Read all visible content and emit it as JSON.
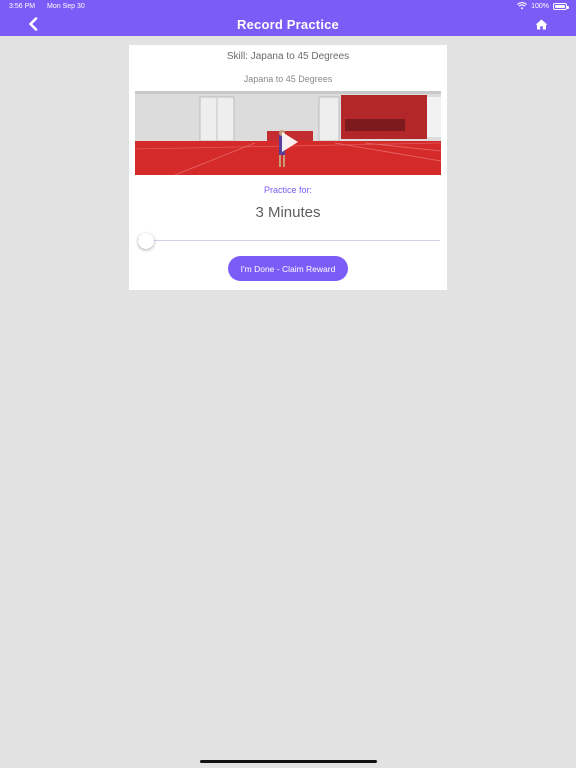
{
  "status_bar": {
    "time": "3:56 PM",
    "date": "Mon Sep 30",
    "battery_text": "100%",
    "wifi_icon": "wifi-icon",
    "battery_icon": "battery-icon"
  },
  "nav": {
    "title": "Record Practice",
    "back_icon": "chevron-left-icon",
    "home_icon": "home-icon",
    "bar_color": "#7c5cf7"
  },
  "card": {
    "skill_title": "Skill: Japana to 45 Degrees",
    "video_title": "Japana to 45 Degrees",
    "video_icon": "play-icon",
    "practice_label": "Practice for:",
    "minutes_text": "3 Minutes",
    "slider": {
      "value": 3,
      "min": 3,
      "max": 60
    },
    "claim_button_label": "I'm Done - Claim Reward"
  },
  "colors": {
    "accent": "#7c5cf7",
    "background": "#e2e2e2",
    "gym_floor": "#d42a2a"
  }
}
